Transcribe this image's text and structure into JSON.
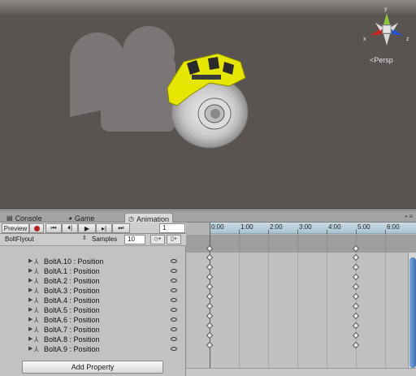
{
  "scene": {
    "persp_label": "Persp",
    "gizmo_axes": [
      "x",
      "y",
      "z"
    ],
    "colors": {
      "background": "#595452",
      "caliper": "#e6e600",
      "gizmo_x": "#c8261c",
      "gizmo_y": "#8cc63f",
      "gizmo_z": "#2a52c8"
    }
  },
  "tabs": [
    {
      "label": "Console",
      "icon": "console-icon"
    },
    {
      "label": "Game",
      "icon": "game-icon"
    },
    {
      "label": "Animation",
      "icon": "animation-clock-icon",
      "active": true
    }
  ],
  "toolbar": {
    "preview_label": "Preview",
    "frame_value": "1"
  },
  "clip": {
    "name": "BoltFlyout",
    "samples_label": "Samples",
    "samples_value": "10"
  },
  "properties": [
    "BoltA.10 : Position",
    "BoltA.1 : Position",
    "BoltA.2 : Position",
    "BoltA.3 : Position",
    "BoltA.4 : Position",
    "BoltA.5 : Position",
    "BoltA.6 : Position",
    "BoltA.7 : Position",
    "BoltA.8 : Position",
    "BoltA.9 : Position"
  ],
  "add_property_label": "Add Property",
  "timeline": {
    "ticks": [
      "0:00",
      "1:00",
      "2:00",
      "3:00",
      "4:00",
      "5:00",
      "6:00"
    ],
    "keyframe_times": [
      "0:00",
      "5:00"
    ],
    "playhead": "0:00"
  }
}
